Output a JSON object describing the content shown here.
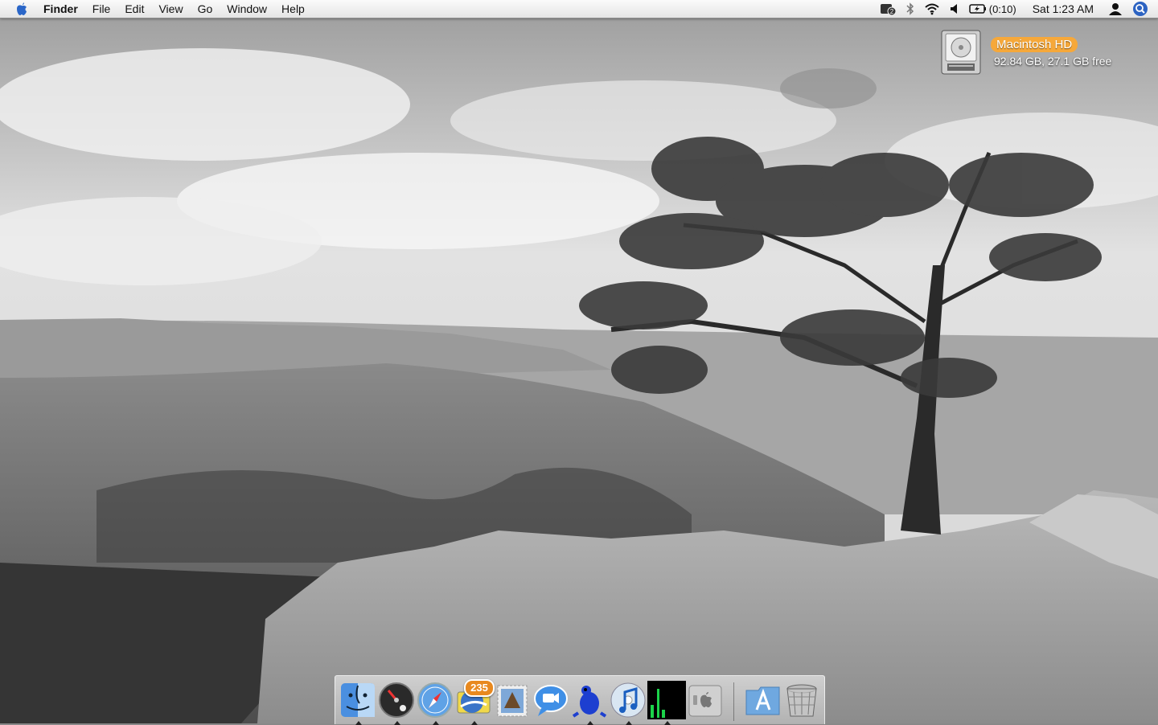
{
  "menubar": {
    "app_name": "Finder",
    "menus": [
      "File",
      "Edit",
      "View",
      "Go",
      "Window",
      "Help"
    ],
    "status": {
      "spaces_number": "2",
      "battery_time": "(0:10)",
      "clock": "Sat 1:23 AM"
    }
  },
  "desktop": {
    "volume": {
      "name": "Macintosh HD",
      "info": "92.84 GB, 27.1 GB free"
    }
  },
  "dock": {
    "items": [
      {
        "icon": "finder-icon",
        "running": true
      },
      {
        "icon": "dashboard-icon",
        "running": true
      },
      {
        "icon": "safari-icon",
        "running": true
      },
      {
        "icon": "thunderbird-icon",
        "running": true,
        "badge": "235"
      },
      {
        "icon": "mail-stamp-icon",
        "running": false
      },
      {
        "icon": "ichat-icon",
        "running": false
      },
      {
        "icon": "frog-app-icon",
        "running": true
      },
      {
        "icon": "itunes-icon",
        "running": true
      },
      {
        "icon": "activity-monitor-icon",
        "running": true
      },
      {
        "icon": "system-preferences-icon",
        "running": false
      },
      {
        "icon": "applications-folder-icon",
        "running": false
      },
      {
        "icon": "trash-icon",
        "running": false
      }
    ]
  },
  "colors": {
    "menubar_bg": "#ececec",
    "volume_label_highlight": "#f6a83a",
    "badge": "#e8891f"
  }
}
